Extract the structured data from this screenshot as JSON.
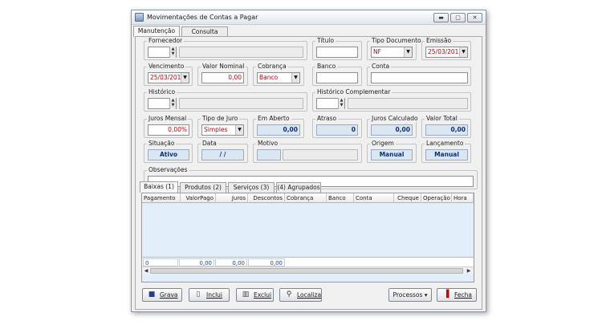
{
  "window": {
    "title": "Movimentações de Contas a Pagar",
    "btn_min": "▬",
    "btn_max": "▢",
    "btn_close": "✕"
  },
  "top_tabs": [
    {
      "label": "Manutenção"
    },
    {
      "label": "Consulta"
    }
  ],
  "form": {
    "fornecedor": {
      "label": "Fornecedor",
      "code": "",
      "name": ""
    },
    "titulo": {
      "label": "Título",
      "value": ""
    },
    "tipo_documento": {
      "label": "Tipo Documento",
      "value": "NF"
    },
    "emissao": {
      "label": "Emissão",
      "value": "25/03/2016"
    },
    "vencimento": {
      "label": "Vencimento",
      "value": "25/03/2016"
    },
    "valor_nominal": {
      "label": "Valor Nominal",
      "value": "0,00"
    },
    "cobranca": {
      "label": "Cobrança",
      "value": "Banco"
    },
    "banco": {
      "label": "Banco",
      "value": ""
    },
    "conta": {
      "label": "Conta",
      "value": ""
    },
    "historico": {
      "label": "Histórico",
      "code": "",
      "text": ""
    },
    "historico_complementar": {
      "label": "Histórico Complementar",
      "code": "",
      "text": ""
    },
    "juros_mensal": {
      "label": "Juros Mensal",
      "value": "0,00%"
    },
    "tipo_de_juro": {
      "label": "Tipo de Juro",
      "value": "Simples"
    },
    "em_aberto": {
      "label": "Em Aberto",
      "value": "0,00"
    },
    "atraso": {
      "label": "Atraso",
      "value": "0"
    },
    "juros_calculado": {
      "label": "Juros Calculado",
      "value": "0,00"
    },
    "valor_total": {
      "label": "Valor Total",
      "value": "0,00"
    },
    "situacao": {
      "label": "Situação",
      "value": "Ativo"
    },
    "data": {
      "label": "Data",
      "value": "/ /"
    },
    "motivo": {
      "label": "Motivo",
      "code": "",
      "text": ""
    },
    "origem": {
      "label": "Origem",
      "value": "Manual"
    },
    "lancamento": {
      "label": "Lançamento",
      "value": "Manual"
    },
    "observacoes": {
      "label": "Observações",
      "value": ""
    }
  },
  "detail_tabs": [
    {
      "label": "Baixas (1)"
    },
    {
      "label": "Produtos (2)"
    },
    {
      "label": "Serviços (3)"
    },
    {
      "label": "(4) Agrupados"
    }
  ],
  "grid": {
    "columns": [
      "Pagamento",
      "ValorPago",
      "Juros",
      "Descontos",
      "Cobrança",
      "Banco",
      "Conta",
      "Cheque",
      "Operação",
      "Hora"
    ],
    "totals": [
      "0",
      "0,00",
      "0,00",
      "0,00"
    ]
  },
  "buttons": {
    "grava": {
      "label": "Grava",
      "icon": "floppy-icon"
    },
    "inclui": {
      "label": "Inclui",
      "icon": "new-document-icon"
    },
    "exclui": {
      "label": "Exclui",
      "icon": "trash-icon"
    },
    "localiza": {
      "label": "Localiza",
      "icon": "magnifier-icon"
    },
    "processos": {
      "label": "Processos ▾"
    },
    "fecha": {
      "label": "Fecha",
      "icon": "exit-door-icon"
    }
  }
}
